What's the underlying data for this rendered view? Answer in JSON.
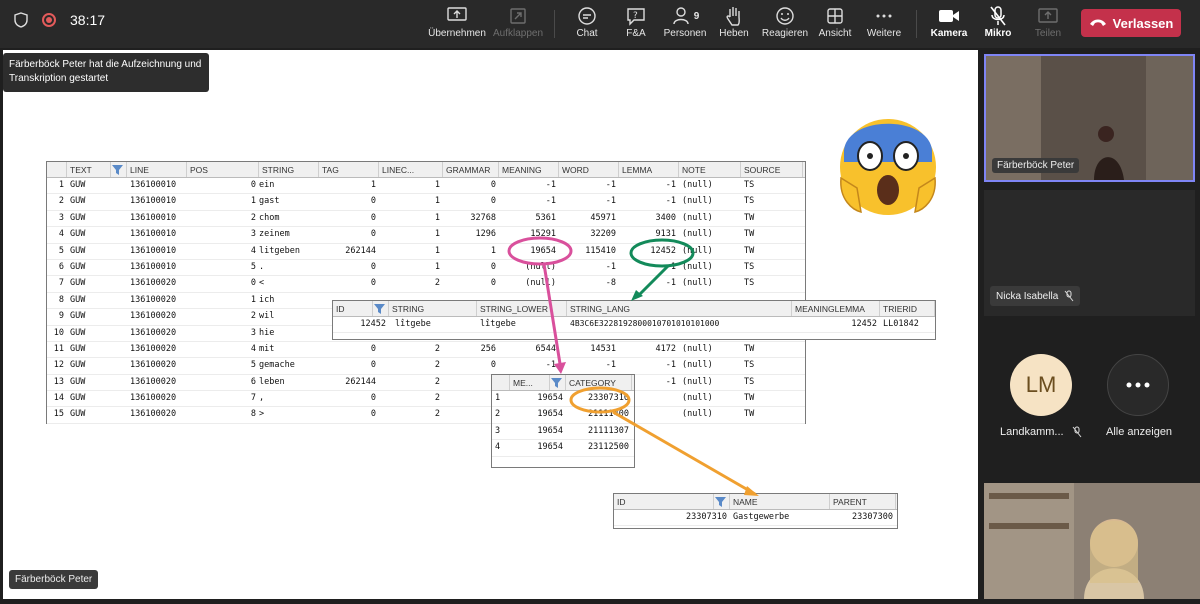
{
  "topbar": {
    "timer": "38:17",
    "buttons": [
      {
        "label": "Übernehmen",
        "icon": "share-screen-icon"
      },
      {
        "label": "Aufklappen",
        "icon": "expand-icon"
      },
      {
        "label": "Chat",
        "icon": "chat-icon"
      },
      {
        "label": "F&A",
        "icon": "qa-icon"
      },
      {
        "label": "Personen",
        "icon": "people-icon",
        "count": "9"
      },
      {
        "label": "Heben",
        "icon": "raise-hand-icon"
      },
      {
        "label": "Reagieren",
        "icon": "smiley-icon"
      },
      {
        "label": "Ansicht",
        "icon": "view-grid-icon"
      },
      {
        "label": "Weitere",
        "icon": "more-icon"
      },
      {
        "label": "Kamera",
        "icon": "camera-icon"
      },
      {
        "label": "Mikro",
        "icon": "mic-muted-icon"
      },
      {
        "label": "Teilen",
        "icon": "share-tray-icon"
      }
    ],
    "leave_label": "Verlassen"
  },
  "tooltip": "Färberböck Peter hat die Aufzeichnung und Transkription gestartet",
  "presenter_tag": "Färberböck Peter",
  "main_table": {
    "columns": [
      "TEXT",
      "LINE",
      "POS",
      "STRING",
      "TAG",
      "LINEC...",
      "GRAMMAR",
      "MEANING",
      "WORD",
      "LEMMA",
      "NOTE",
      "SOURCE"
    ],
    "rows": [
      [
        "1",
        "GUW",
        "136100010",
        "0",
        "ein",
        "1",
        "1",
        "0",
        "-1",
        "-1",
        "-1",
        "(null)",
        "TS"
      ],
      [
        "2",
        "GUW",
        "136100010",
        "1",
        "gast",
        "0",
        "1",
        "0",
        "-1",
        "-1",
        "-1",
        "(null)",
        "TS"
      ],
      [
        "3",
        "GUW",
        "136100010",
        "2",
        "chom",
        "0",
        "1",
        "32768",
        "5361",
        "45971",
        "3400",
        "(null)",
        "TW"
      ],
      [
        "4",
        "GUW",
        "136100010",
        "3",
        "zeinem",
        "0",
        "1",
        "1296",
        "15291",
        "32209",
        "9131",
        "(null)",
        "TW"
      ],
      [
        "5",
        "GUW",
        "136100010",
        "4",
        "litgeben",
        "262144",
        "1",
        "1",
        "19654",
        "115410",
        "12452",
        "(null)",
        "TW"
      ],
      [
        "6",
        "GUW",
        "136100010",
        "5",
        ".",
        "0",
        "1",
        "0",
        "(null)",
        "-1",
        "-1",
        "(null)",
        "TS"
      ],
      [
        "7",
        "GUW",
        "136100020",
        "0",
        "<",
        "0",
        "2",
        "0",
        "(null)",
        "-8",
        "-1",
        "(null)",
        "TS"
      ],
      [
        "8",
        "GUW",
        "136100020",
        "1",
        "ich",
        "",
        "",
        "",
        "",
        "",
        "",
        "",
        ""
      ],
      [
        "9",
        "GUW",
        "136100020",
        "2",
        "wil",
        "",
        "",
        "",
        "",
        "",
        "",
        "",
        ""
      ],
      [
        "10",
        "GUW",
        "136100020",
        "3",
        "hie",
        "",
        "",
        "",
        "",
        "",
        "",
        "",
        ""
      ],
      [
        "11",
        "GUW",
        "136100020",
        "4",
        "mit",
        "0",
        "2",
        "256",
        "6544",
        "14531",
        "4172",
        "(null)",
        "TW"
      ],
      [
        "12",
        "GUW",
        "136100020",
        "5",
        "gemache",
        "0",
        "2",
        "0",
        "-1",
        "-1",
        "-1",
        "(null)",
        "TS"
      ],
      [
        "13",
        "GUW",
        "136100020",
        "6",
        "leben",
        "262144",
        "2",
        "",
        "",
        "",
        "-1",
        "(null)",
        "TS"
      ],
      [
        "14",
        "GUW",
        "136100020",
        "7",
        ",",
        "0",
        "2",
        "",
        "",
        "",
        "",
        "(null)",
        "TW"
      ],
      [
        "15",
        "GUW",
        "136100020",
        "8",
        ">",
        "0",
        "2",
        "",
        "",
        "",
        "",
        "(null)",
        "TW"
      ]
    ]
  },
  "string_table": {
    "columns": [
      "ID",
      "STRING",
      "STRING_LOWER",
      "STRING_LANG",
      "MEANINGLEMMA",
      "TRIERID"
    ],
    "row": [
      "12452",
      "lîtgebe",
      "lîtgebe",
      "4B3C6E3228192800010701010101000",
      "12452",
      "LL01842"
    ]
  },
  "category_table": {
    "columns": [
      "ME...",
      "CATEGORY"
    ],
    "rows": [
      [
        "1",
        "19654",
        "23307310"
      ],
      [
        "2",
        "19654",
        "21111400"
      ],
      [
        "3",
        "19654",
        "21111307"
      ],
      [
        "4",
        "19654",
        "23112500"
      ]
    ]
  },
  "name_table": {
    "columns": [
      "ID",
      "NAME",
      "PARENT"
    ],
    "row": [
      "23307310",
      "Gastgewerbe",
      "23307300"
    ]
  },
  "participants": [
    {
      "name": "Färberböck Peter"
    },
    {
      "name": "Nicka Isabella"
    },
    {
      "name": "Landkamm...",
      "initials": "LM"
    },
    {
      "name": "Alle anzeigen"
    }
  ],
  "colors": {
    "leave": "#c4314b",
    "pink": "#d9509c",
    "green": "#138a5a",
    "orange": "#f0a030",
    "avatar_bg": "#f6e3c4"
  }
}
